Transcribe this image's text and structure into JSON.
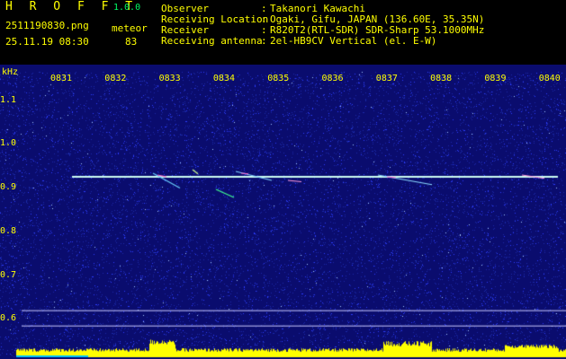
{
  "header": {
    "app_title": "H R O F F T",
    "version": "1.0.0",
    "file_name": "2511190830.png",
    "meteor_label": "meteor",
    "date_time": "25.11.19 08:30",
    "meteor_count": "83"
  },
  "info": [
    {
      "key": "Observer",
      "value": "Takanori Kawachi"
    },
    {
      "key": "Receiving Location",
      "value": "Ogaki, Gifu, JAPAN (136.60E, 35.35N)"
    },
    {
      "key": "Receiver",
      "value": "R820T2(RTL-SDR) SDR-Sharp 53.1000MHz"
    },
    {
      "key": "Receiving antenna",
      "value": "2el-HB9CV Vertical (el. E-W)"
    }
  ],
  "info_separator": ":",
  "spectrogram": {
    "unit_label": "kHz",
    "time_ticks": [
      "0831",
      "0832",
      "0833",
      "0834",
      "0835",
      "0836",
      "0837",
      "0838",
      "0839",
      "0840"
    ],
    "freq_ticks": [
      "1.1",
      "1.0",
      "0.9",
      "0.8",
      "0.7",
      "0.6"
    ],
    "carrier_freq_khz": 0.925,
    "freq_range_khz": [
      0.57,
      1.165
    ],
    "colors": {
      "background": "#0a0c6e",
      "noise": "#2c3cff",
      "carrier": "#9cffe6",
      "echo": "#ff66cc",
      "power_bar": "#ffff00",
      "power_base": "#00c8ff",
      "label": "#ffff00",
      "grid": "#c8c8ff"
    }
  }
}
